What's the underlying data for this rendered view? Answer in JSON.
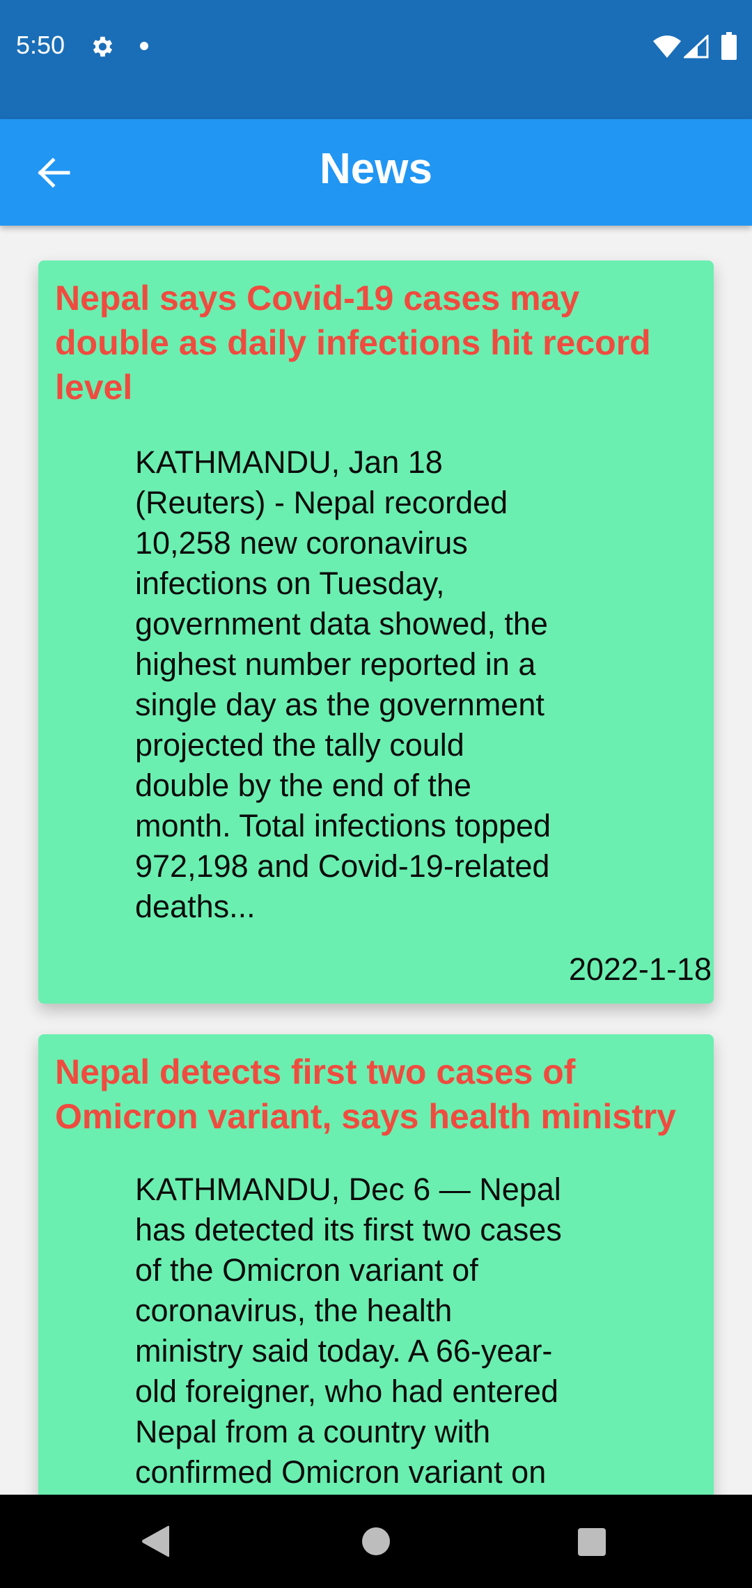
{
  "status_bar": {
    "time": "5:50",
    "icons": [
      "gear-icon",
      "notification-dot-icon",
      "wifi-icon",
      "cell-signal-icon",
      "battery-icon"
    ]
  },
  "app_bar": {
    "title": "News",
    "back_icon": "arrow-left-icon",
    "background": "#2196f3"
  },
  "news": [
    {
      "title": "Nepal says Covid-19 cases may double as daily infections hit record level",
      "body_lines": [
        "KATHMANDU, Jan 18",
        "(Reuters) - Nepal recorded",
        "10,258 new coronavirus",
        "infections on Tuesday,",
        "government data showed, the",
        "highest number reported in a",
        "single day as the government",
        "projected the tally could",
        "double by the end of the",
        "month. Total infections topped",
        "972,198 and Covid-19-related",
        "deaths..."
      ],
      "date": "2022-1-18"
    },
    {
      "title": "Nepal detects first two cases of Omicron variant, says health ministry",
      "body_lines": [
        "KATHMANDU, Dec 6 — Nepal",
        "has detected its first two cases",
        "of the Omicron variant of",
        "coronavirus, the health",
        "ministry said today. A 66-year-",
        "old foreigner, who had entered",
        "Nepal from a country with",
        "confirmed Omicron variant on"
      ]
    }
  ],
  "colors": {
    "status_bar": "#1a6eb7",
    "card_background": "#6aefb0",
    "card_title": "#f04b3f"
  },
  "nav_bar": {
    "icons": [
      "nav-back-icon",
      "nav-home-icon",
      "nav-recents-icon"
    ]
  }
}
